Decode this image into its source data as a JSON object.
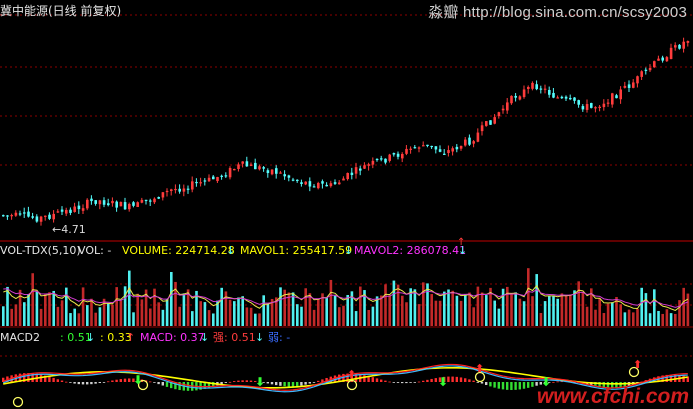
{
  "title": "冀中能源(日线 前复权)",
  "watermark_top": "淼瓣 http://blog.sina.com.cn/scsy2003",
  "watermark_bottom": "www.cfchi.com",
  "low_marker": "←4.71",
  "volume_panel": {
    "name": "VOL-TDX(5,10)",
    "vol": "VOL: -",
    "volume": "VOLUME: 224714.28",
    "mavol1": "MAVOL1: 255417.59",
    "mavol2": "MAVOL2: 286078.41"
  },
  "macd_panel": {
    "name": "MACD2",
    "v1": ": 0.51",
    "v2": ": 0.33",
    "macd": "MACD: 0.37",
    "strong": "强: 0.51",
    "weak": "弱: -"
  },
  "colors": {
    "up": "#ff3c3c",
    "down": "#54fcfc",
    "yellow": "#ffff00",
    "magenta": "#ff33ff",
    "green": "#33ff33",
    "grid": "#8b0000"
  }
}
